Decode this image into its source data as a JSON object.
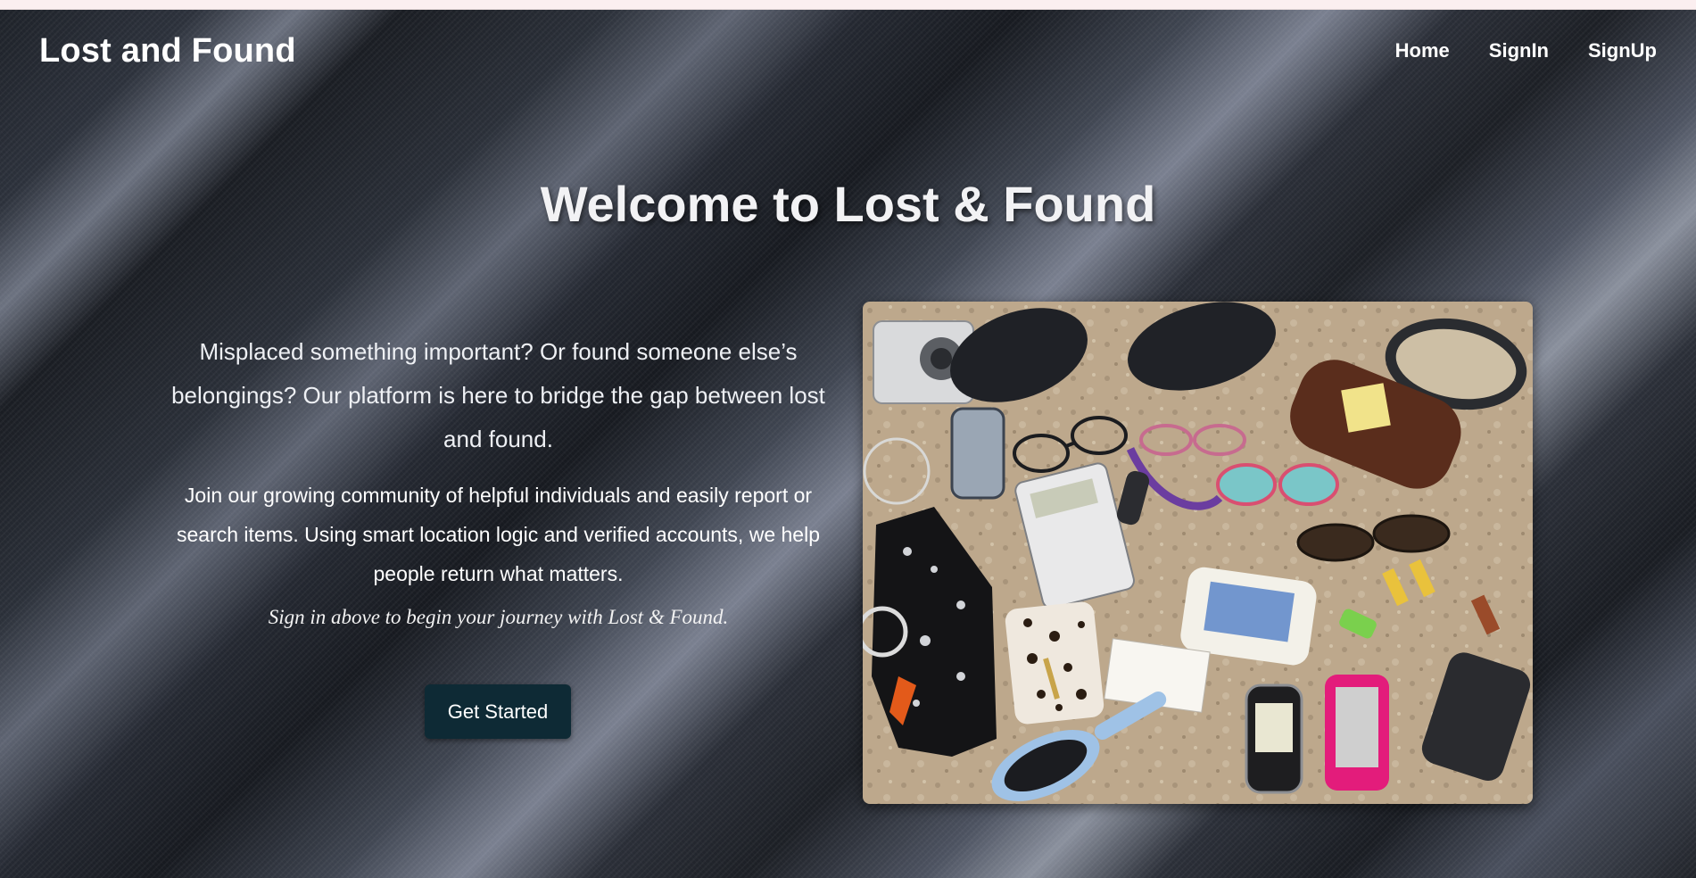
{
  "navbar": {
    "brand": "Lost and Found",
    "links": [
      "Home",
      "SignIn",
      "SignUp"
    ]
  },
  "hero": {
    "title": "Welcome to Lost & Found",
    "lead": "Misplaced something important? Or found someone else’s belongings? Our platform is here to bridge the gap between lost and found.",
    "body": "Join our growing community of helpful individuals and easily report or search items. Using smart location logic and verified accounts, we help people return what matters.",
    "note": "Sign in above to begin your journey with Lost & Found.",
    "cta_label": "Get Started"
  },
  "image": {
    "subject": "flat-lay of lost items: camera, phones, glasses cases, eyeglasses, calculator, keys, glove with jewelry, hairbrush, USB drives, pouches"
  },
  "colors": {
    "top_bar": "#fbeff0",
    "button_bg": "#0e2a35",
    "text": "#ffffff"
  }
}
